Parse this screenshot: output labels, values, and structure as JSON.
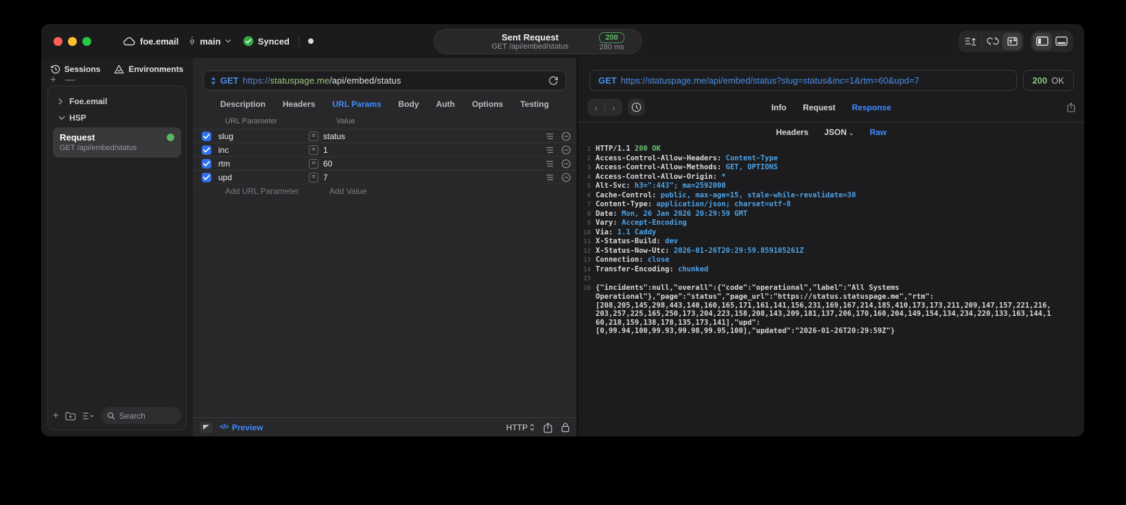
{
  "window": {
    "project": "foe.email",
    "branch": "main",
    "sync_status": "Synced"
  },
  "header": {
    "title": "Sent Request",
    "subtitle": "GET /api/embed/status",
    "status_code": "200",
    "duration": "280 ms"
  },
  "sidebar": {
    "tabs": [
      {
        "label": "Sessions"
      },
      {
        "label": "Environments"
      }
    ],
    "tree": [
      {
        "label": "Foe.email"
      },
      {
        "label": "HSP"
      }
    ],
    "request_item": {
      "title": "Request",
      "subtitle": "GET /api/embed/status"
    },
    "search_placeholder": "Search"
  },
  "request_panel": {
    "method": "GET",
    "url_scheme": "https://",
    "url_host": "statuspage.me",
    "url_path": "/api/embed/status",
    "tabs": [
      "Description",
      "Headers",
      "URL Params",
      "Body",
      "Auth",
      "Options",
      "Testing"
    ],
    "active_tab": "URL Params",
    "table": {
      "col_param": "URL Parameter",
      "col_value": "Value",
      "rows": [
        {
          "name": "slug",
          "value": "status",
          "checked": true
        },
        {
          "name": "inc",
          "value": "1",
          "checked": true
        },
        {
          "name": "rtm",
          "value": "60",
          "checked": true
        },
        {
          "name": "upd",
          "value": "7",
          "checked": true
        }
      ],
      "add_param_placeholder": "Add URL Parameter",
      "add_value_placeholder": "Add Value"
    },
    "footer": {
      "preview_label": "Preview",
      "http_label": "HTTP"
    }
  },
  "response_panel": {
    "method": "GET",
    "url": "https://statuspage.me/api/embed/status?slug=status&inc=1&rtm=60&upd=7",
    "status_code": "200",
    "status_text": "OK",
    "tabs": [
      "Info",
      "Request",
      "Response"
    ],
    "active_tab": "Response",
    "subtabs": [
      "Headers",
      "JSON",
      "Raw"
    ],
    "active_subtab": "Raw",
    "body_lines": [
      {
        "n": "1",
        "parts": [
          {
            "t": "HTTP/1.1 ",
            "c": "plain"
          },
          {
            "t": "200 OK",
            "c": "green"
          }
        ]
      },
      {
        "n": "2",
        "parts": [
          {
            "t": "Access-Control-Allow-Headers: ",
            "c": "plain"
          },
          {
            "t": "Content-Type",
            "c": "blue"
          }
        ]
      },
      {
        "n": "3",
        "parts": [
          {
            "t": "Access-Control-Allow-Methods: ",
            "c": "plain"
          },
          {
            "t": "GET, OPTIONS",
            "c": "blue"
          }
        ]
      },
      {
        "n": "4",
        "parts": [
          {
            "t": "Access-Control-Allow-Origin: ",
            "c": "plain"
          },
          {
            "t": "*",
            "c": "blue"
          }
        ]
      },
      {
        "n": "5",
        "parts": [
          {
            "t": "Alt-Svc: ",
            "c": "plain"
          },
          {
            "t": "h3=\":443\"; ma=2592000",
            "c": "blue"
          }
        ]
      },
      {
        "n": "6",
        "parts": [
          {
            "t": "Cache-Control: ",
            "c": "plain"
          },
          {
            "t": "public, max-age=15, stale-while-revalidate=30",
            "c": "blue"
          }
        ]
      },
      {
        "n": "7",
        "parts": [
          {
            "t": "Content-Type: ",
            "c": "plain"
          },
          {
            "t": "application/json; charset=utf-8",
            "c": "blue"
          }
        ]
      },
      {
        "n": "8",
        "parts": [
          {
            "t": "Date: ",
            "c": "plain"
          },
          {
            "t": "Mon, 26 Jan 2026 20:29:59 GMT",
            "c": "blue"
          }
        ]
      },
      {
        "n": "9",
        "parts": [
          {
            "t": "Vary: ",
            "c": "plain"
          },
          {
            "t": "Accept-Encoding",
            "c": "blue"
          }
        ]
      },
      {
        "n": "10",
        "parts": [
          {
            "t": "Via: ",
            "c": "plain"
          },
          {
            "t": "1.1 Caddy",
            "c": "blue"
          }
        ]
      },
      {
        "n": "11",
        "parts": [
          {
            "t": "X-Status-Build: ",
            "c": "plain"
          },
          {
            "t": "dev",
            "c": "blue"
          }
        ]
      },
      {
        "n": "12",
        "parts": [
          {
            "t": "X-Status-Now-Utc: ",
            "c": "plain"
          },
          {
            "t": "2026-01-26T20:29:59.859105261Z",
            "c": "blue"
          }
        ]
      },
      {
        "n": "13",
        "parts": [
          {
            "t": "Connection: ",
            "c": "plain"
          },
          {
            "t": "close",
            "c": "blue"
          }
        ]
      },
      {
        "n": "14",
        "parts": [
          {
            "t": "Transfer-Encoding: ",
            "c": "plain"
          },
          {
            "t": "chunked",
            "c": "blue"
          }
        ]
      },
      {
        "n": "15",
        "parts": []
      },
      {
        "n": "16",
        "parts": [
          {
            "t": "{\"incidents\":null,\"overall\":{\"code\":\"operational\",\"label\":\"All Systems",
            "c": "plain"
          }
        ]
      },
      {
        "n": "",
        "parts": [
          {
            "t": "Operational\"},\"page\":\"status\",\"page_url\":\"https://status.statuspage.me\",\"rtm\":",
            "c": "plain"
          }
        ]
      },
      {
        "n": "",
        "parts": [
          {
            "t": "[208,205,145,298,443,140,160,165,171,161,141,156,231,169,167,214,185,410,173,173,211,209,147,157,221,216,",
            "c": "plain"
          }
        ]
      },
      {
        "n": "",
        "parts": [
          {
            "t": "203,257,225,165,250,173,204,223,158,208,143,209,181,137,206,170,160,204,149,154,134,234,220,133,163,144,1",
            "c": "plain"
          }
        ]
      },
      {
        "n": "",
        "parts": [
          {
            "t": "60,218,159,138,178,135,173,141],\"upd\":",
            "c": "plain"
          }
        ]
      },
      {
        "n": "",
        "parts": [
          {
            "t": "[0,99.94,100,99.93,99.98,99.95,100],\"updated\":\"2026-01-26T20:29:59Z\"}",
            "c": "plain"
          }
        ]
      }
    ]
  },
  "colors": {
    "accent_blue": "#3f8cff",
    "value_blue": "#4da2e6",
    "method_blue": "#4a8de6",
    "host_green": "#9fc87e",
    "status_green": "#5fbf66",
    "body_green": "#6cc070",
    "checkbox_blue": "#3071e8",
    "request_dot_green": "#55b85e",
    "traffic_red": "#ff5f57",
    "traffic_yellow": "#febc2e",
    "traffic_green": "#28c840"
  }
}
